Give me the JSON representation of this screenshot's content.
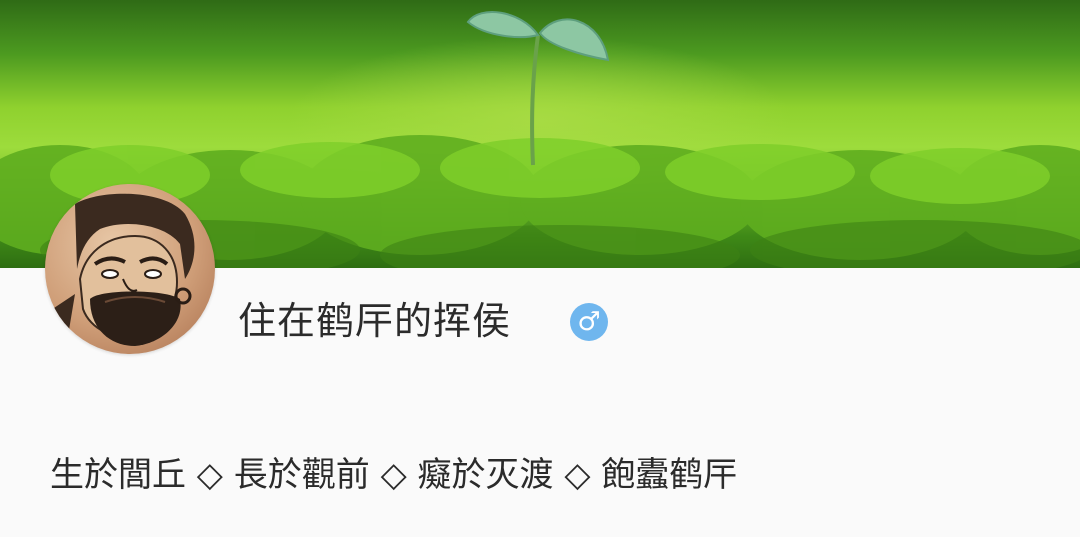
{
  "profile": {
    "username": "住在鹤厈的挥侯",
    "gender_icon": "male-icon",
    "gender_symbol": "♂",
    "bio": "生於閭丘 ◇ 長於觀前 ◇ 癡於灭渡 ◇ 飽蠹鹤厈",
    "colors": {
      "gender_badge": "#6fb6ee",
      "text": "#2b2b2b",
      "background": "#fafafa"
    }
  },
  "banner": {
    "image": "green-moss-sprout-photo"
  },
  "avatar": {
    "image": "bearded-figure-ink-portrait"
  }
}
